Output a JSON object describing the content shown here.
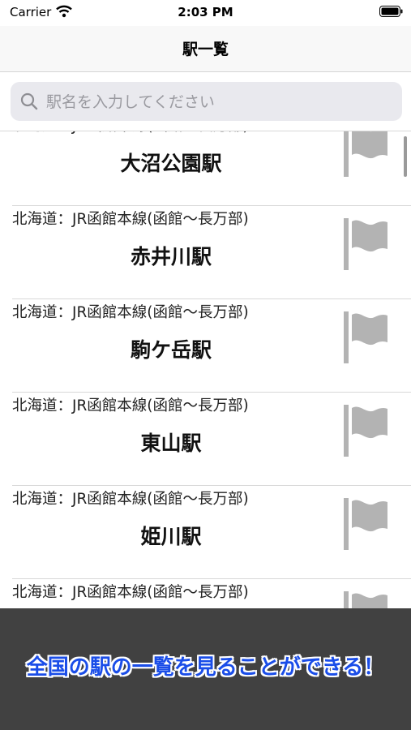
{
  "status_bar": {
    "carrier": "Carrier",
    "time": "2:03 PM"
  },
  "nav": {
    "title": "駅一覧"
  },
  "search": {
    "placeholder": "駅名を入力してください",
    "value": ""
  },
  "stations": [
    {
      "line": "北海道：JR函館本線(函館〜長万部)",
      "name": "大沼公園駅"
    },
    {
      "line": "北海道：JR函館本線(函館〜長万部)",
      "name": "赤井川駅"
    },
    {
      "line": "北海道：JR函館本線(函館〜長万部)",
      "name": "駒ケ岳駅"
    },
    {
      "line": "北海道：JR函館本線(函館〜長万部)",
      "name": "東山駅"
    },
    {
      "line": "北海道：JR函館本線(函館〜長万部)",
      "name": "姫川駅"
    },
    {
      "line": "北海道：JR函館本線(函館〜長万部)",
      "name": ""
    }
  ],
  "banner": {
    "text": "全国の駅の一覧を見ることができる！"
  },
  "colors": {
    "flag": "#b3b3b3",
    "banner_bg": "#414141",
    "banner_text": "#1a4de8"
  }
}
